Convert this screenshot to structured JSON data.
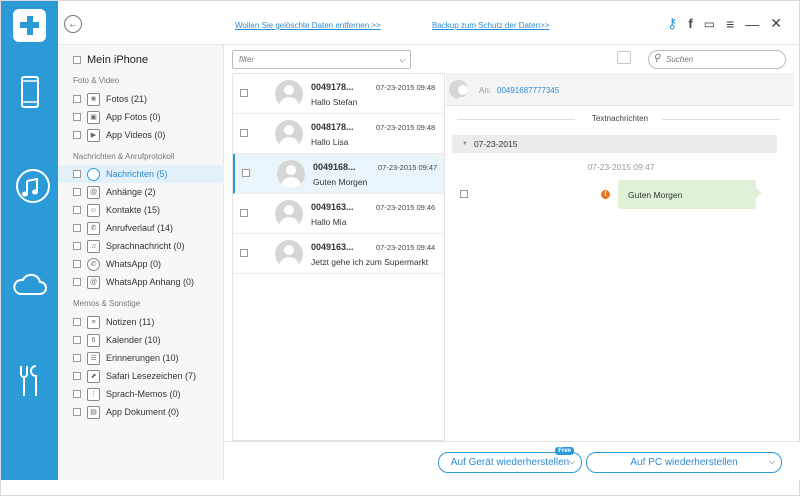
{
  "topbar": {
    "link_delete": "Wollen Sie gelöschte Daten entfernen >>",
    "link_backup": "Backup zum Schutz der Daten>>"
  },
  "sidebar": {
    "title": "Mein iPhone",
    "categories": [
      "Foto & Video",
      "Nachrichten & Anrufprotokoll",
      "Memos & Sonstige"
    ],
    "items": [
      {
        "label": "Fotos (21)",
        "icon": "photo-icon"
      },
      {
        "label": "App Fotos (0)",
        "icon": "app-photo-icon"
      },
      {
        "label": "App Videos (0)",
        "icon": "video-icon"
      },
      {
        "label": "Nachrichten (5)",
        "icon": "message-icon",
        "active": true
      },
      {
        "label": "Anhänge (2)",
        "icon": "attachment-icon"
      },
      {
        "label": "Kontakte (15)",
        "icon": "contacts-icon"
      },
      {
        "label": "Anrufverlauf (14)",
        "icon": "phone-icon"
      },
      {
        "label": "Sprachnachricht (0)",
        "icon": "voicemail-icon"
      },
      {
        "label": "WhatsApp (0)",
        "icon": "whatsapp-icon"
      },
      {
        "label": "WhatsApp Anhang (0)",
        "icon": "whatsapp-attachment-icon"
      },
      {
        "label": "Notizen (11)",
        "icon": "notes-icon"
      },
      {
        "label": "Kalender (10)",
        "icon": "calendar-icon",
        "glyph": "6"
      },
      {
        "label": "Erinnerungen (10)",
        "icon": "reminders-icon"
      },
      {
        "label": "Safari Lesezeichen (7)",
        "icon": "bookmark-icon"
      },
      {
        "label": "Sprach-Memos (0)",
        "icon": "voice-memo-icon"
      },
      {
        "label": "App Dokument (0)",
        "icon": "document-icon"
      }
    ]
  },
  "toolbar": {
    "filter_placeholder": "filter",
    "search_placeholder": "Suchen"
  },
  "messages": [
    {
      "number": "0049178...",
      "time": "07-23-2015 09:48",
      "text": "Hallo Stefan"
    },
    {
      "number": "0048178...",
      "time": "07-23-2015 09:48",
      "text": "Hallo Lisa"
    },
    {
      "number": "0049168...",
      "time": "07-23-2015 09:47",
      "text": "Guten Morgen",
      "active": true
    },
    {
      "number": "0049163...",
      "time": "07-23-2015 09:46",
      "text": "Hallo Mia"
    },
    {
      "number": "0049163...",
      "time": "07-23-2015 09:44",
      "text": "Jetzt gehe ich zum Supermarkt"
    }
  ],
  "detail": {
    "to_label": "An:",
    "to_number": "00491687777345",
    "section_title": "Textnachrichten",
    "date_group": "07-23-2015",
    "timestamp": "07-23-2015 09:47",
    "bubble_text": "Guten Morgen"
  },
  "footer": {
    "restore_device": "Auf Gerät wiederherstellen",
    "free_badge": "Free",
    "restore_pc": "Auf PC wiederherstellen"
  },
  "colors": {
    "accent": "#2d9ad8",
    "bubble": "#dff2d8",
    "warning": "#e87722"
  }
}
